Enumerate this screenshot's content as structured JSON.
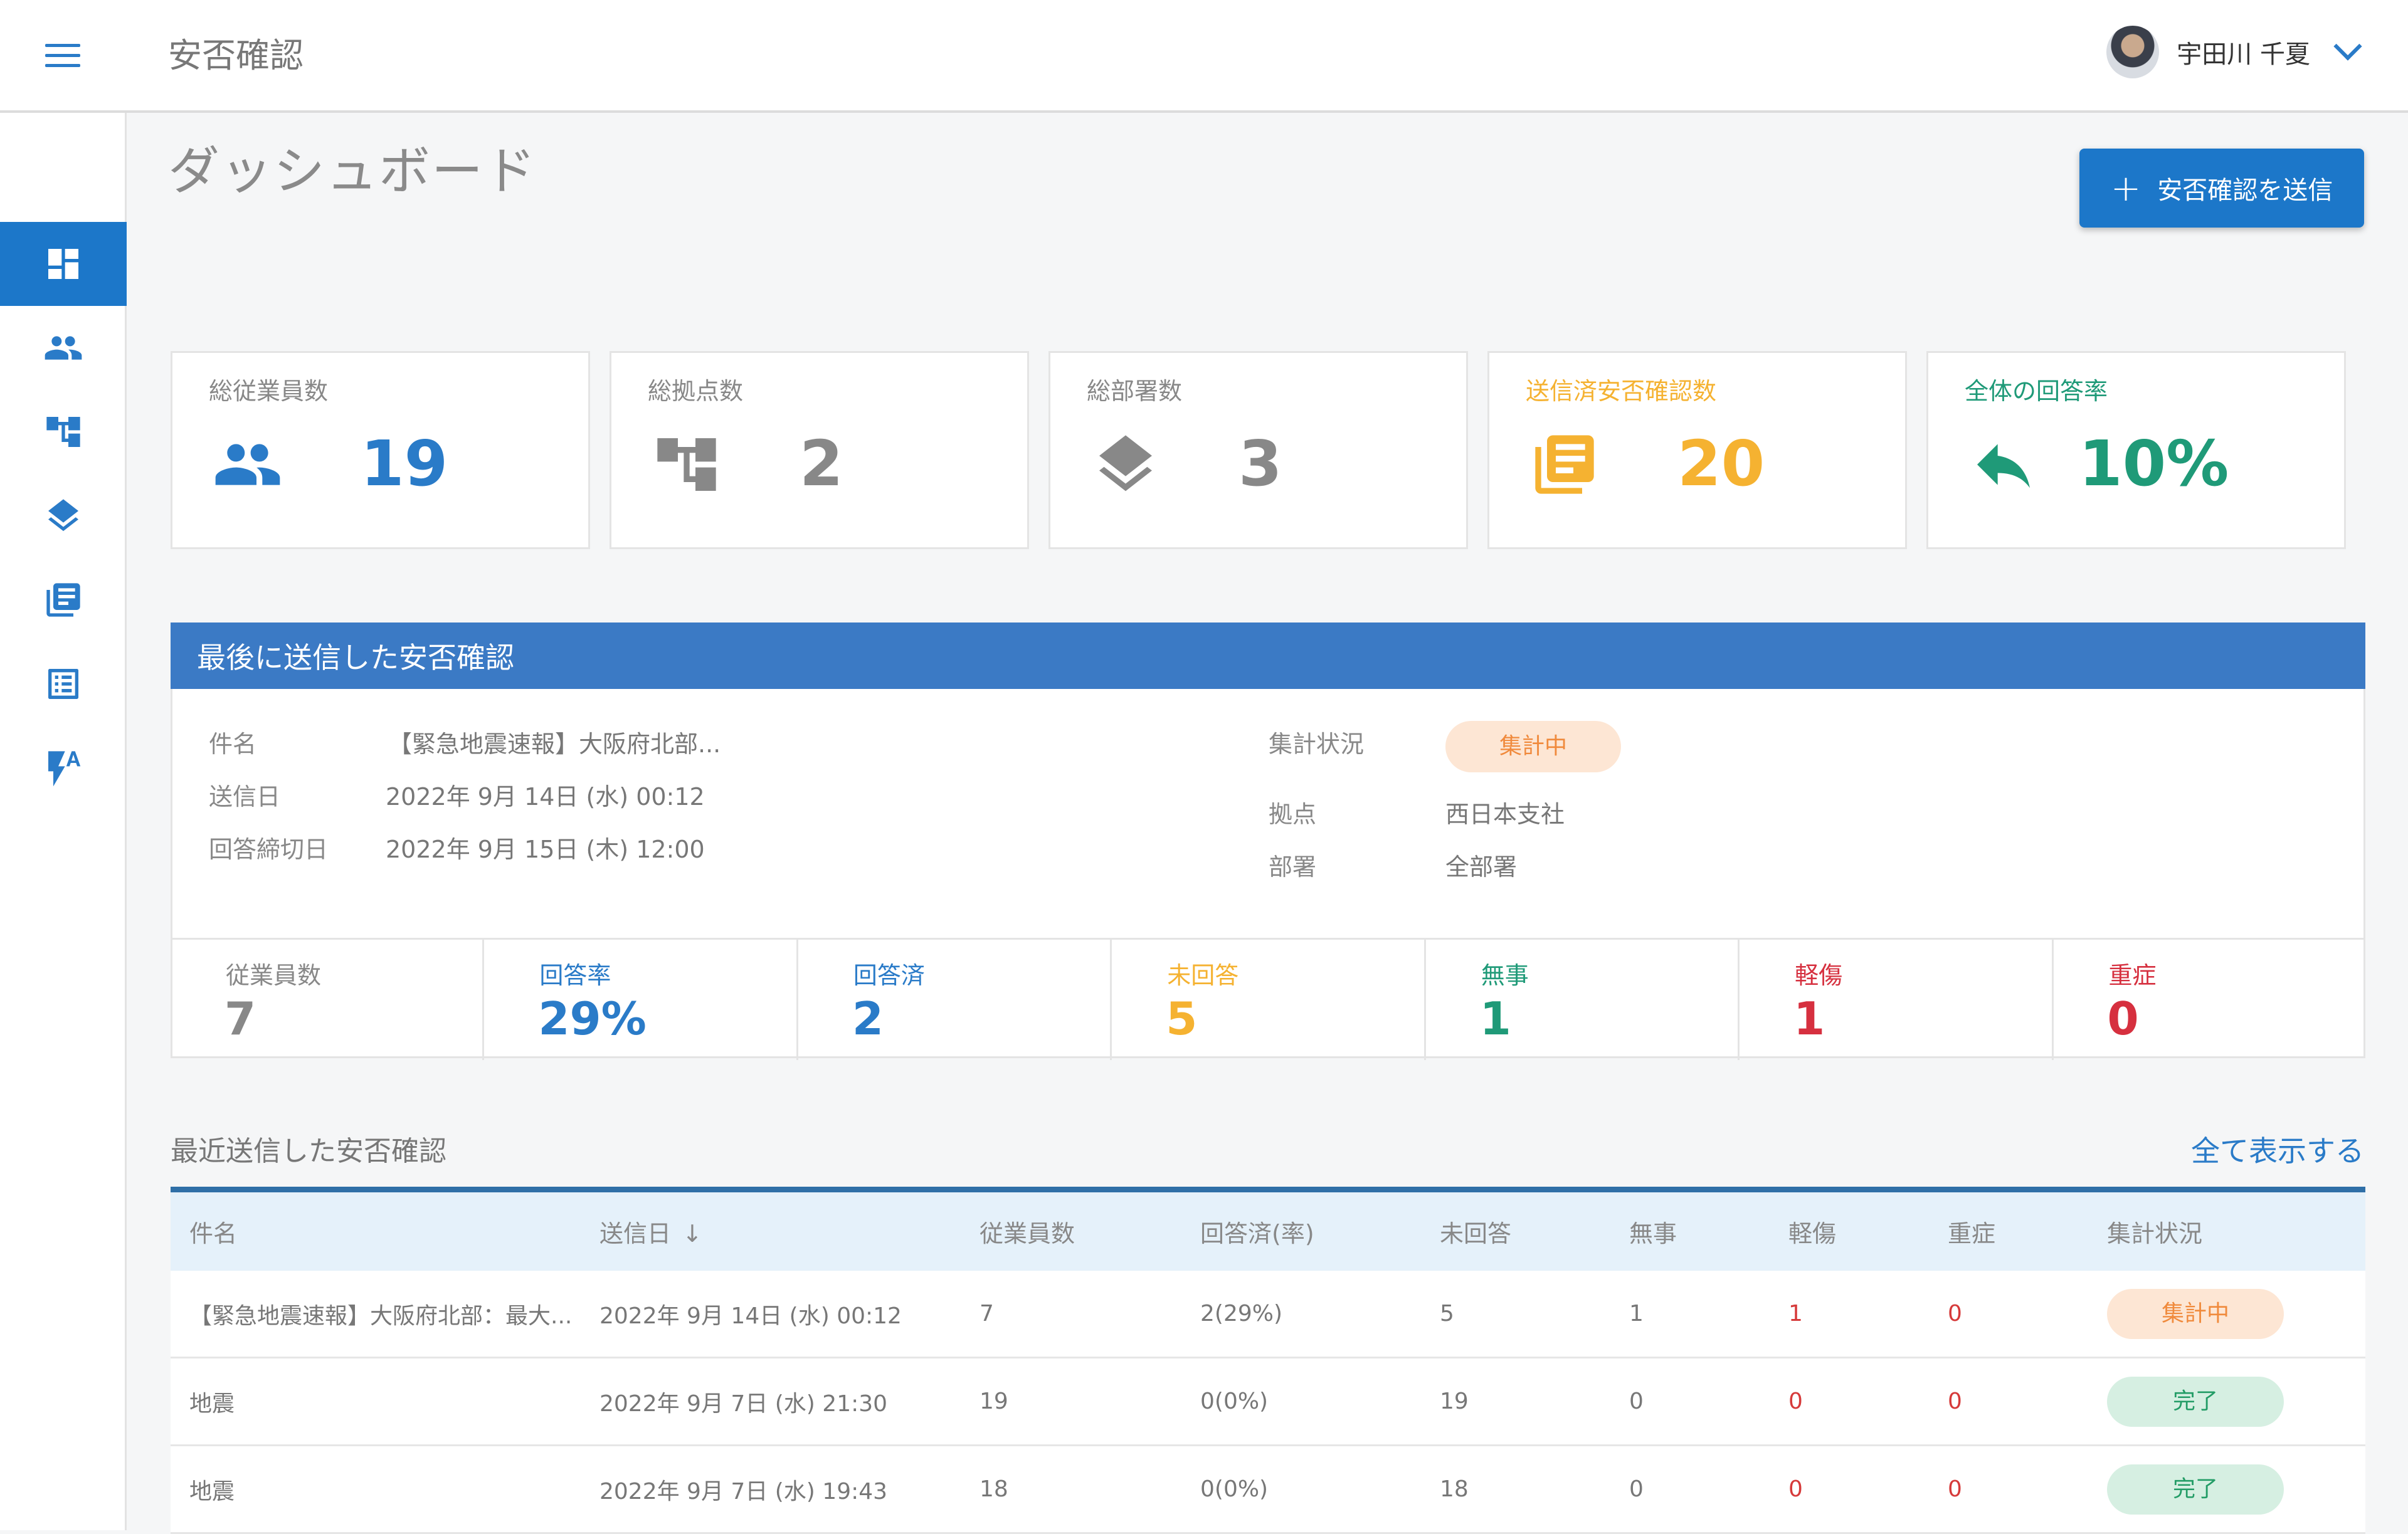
{
  "header": {
    "app_title": "安否確認",
    "user_name": "宇田川 千夏"
  },
  "sidebar": {
    "items": [
      {
        "icon": "dashboard-icon",
        "active": true
      },
      {
        "icon": "people-icon",
        "active": false
      },
      {
        "icon": "hierarchy-icon",
        "active": false
      },
      {
        "icon": "layers-icon",
        "active": false
      },
      {
        "icon": "news-icon",
        "active": false
      },
      {
        "icon": "list-icon",
        "active": false
      },
      {
        "icon": "flash-auto-icon",
        "active": false
      }
    ]
  },
  "page": {
    "title": "ダッシュボード",
    "send_button": "安否確認を送信"
  },
  "stats": [
    {
      "label": "総従業員数",
      "value": "19",
      "icon": "people-icon",
      "color": "#2a7bc8"
    },
    {
      "label": "総拠点数",
      "value": "2",
      "icon": "hierarchy-icon",
      "color": "#888888"
    },
    {
      "label": "総部署数",
      "value": "3",
      "icon": "layers-icon",
      "color": "#888888"
    },
    {
      "label": "送信済安否確認数",
      "value": "20",
      "icon": "news-icon",
      "color": "#f5b231"
    },
    {
      "label": "全体の回答率",
      "value": "10%",
      "icon": "reply-icon",
      "color": "#1f9a78"
    }
  ],
  "latest": {
    "header": "最後に送信した安否確認",
    "fields": {
      "subject_label": "件名",
      "subject": "【緊急地震速報】大阪府北部...",
      "sent_label": "送信日",
      "sent": "2022年 9月 14日 (水) 00:12",
      "deadline_label": "回答締切日",
      "deadline": "2022年 9月 15日 (木) 12:00",
      "status_label": "集計状況",
      "status": "集計中",
      "base_label": "拠点",
      "base": "西日本支社",
      "dept_label": "部署",
      "dept": "全部署"
    },
    "metrics": [
      {
        "label": "従業員数",
        "value": "7",
        "color": "#888888"
      },
      {
        "label": "回答率",
        "value": "29%",
        "color": "#2a7bc8"
      },
      {
        "label": "回答済",
        "value": "2",
        "color": "#2a7bc8"
      },
      {
        "label": "未回答",
        "value": "5",
        "color": "#f5b231"
      },
      {
        "label": "無事",
        "value": "1",
        "color": "#1f9a78"
      },
      {
        "label": "軽傷",
        "value": "1",
        "color": "#d6303f"
      },
      {
        "label": "重症",
        "value": "0",
        "color": "#d6303f"
      }
    ]
  },
  "recent": {
    "title": "最近送信した安否確認",
    "see_all": "全て表示する",
    "columns": [
      "件名",
      "送信日",
      "従業員数",
      "回答済(率)",
      "未回答",
      "無事",
      "軽傷",
      "重症",
      "集計状況"
    ],
    "rows": [
      {
        "subject": "【緊急地震速報】大阪府北部：最大...",
        "sent": "2022年 9月 14日 (水) 00:12",
        "employees": "7",
        "answered": "2(29%)",
        "unanswered": "5",
        "safe": "1",
        "minor": "1",
        "severe": "0",
        "status": "集計中",
        "status_type": "orange"
      },
      {
        "subject": "地震",
        "sent": "2022年 9月 7日 (水) 21:30",
        "employees": "19",
        "answered": "0(0%)",
        "unanswered": "19",
        "safe": "0",
        "minor": "0",
        "severe": "0",
        "status": "完了",
        "status_type": "green"
      },
      {
        "subject": "地震",
        "sent": "2022年 9月 7日 (水) 19:43",
        "employees": "18",
        "answered": "0(0%)",
        "unanswered": "18",
        "safe": "0",
        "minor": "0",
        "severe": "0",
        "status": "完了",
        "status_type": "green"
      }
    ]
  }
}
